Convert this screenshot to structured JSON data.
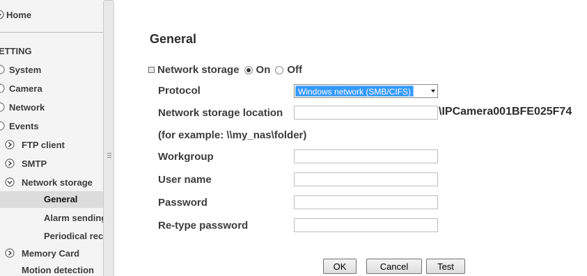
{
  "sidebar": {
    "home_label": "Home",
    "section_label": "ETTING",
    "items": [
      {
        "label": "System"
      },
      {
        "label": "Camera"
      },
      {
        "label": "Network"
      },
      {
        "label": "Events"
      },
      {
        "label": "FTP client"
      },
      {
        "label": "SMTP"
      },
      {
        "label": "Network storage"
      },
      {
        "label": "General"
      },
      {
        "label": "Alarm sending"
      },
      {
        "label": "Periodical recc"
      },
      {
        "label": "Memory Card"
      },
      {
        "label": "Motion detection"
      }
    ],
    "selected": "General"
  },
  "main": {
    "title": "General",
    "network_storage": {
      "label": "Network storage",
      "on_label": "On",
      "off_label": "Off",
      "selected": "On"
    },
    "protocol": {
      "label": "Protocol",
      "value": "Windows network (SMB/CIFS)"
    },
    "location": {
      "label": "Network storage location",
      "value": "",
      "suffix": "\\IPCamera001BFE025F74"
    },
    "example_text": "(for example: \\\\my_nas\\folder)",
    "workgroup": {
      "label": "Workgroup",
      "value": ""
    },
    "username": {
      "label": "User name",
      "value": ""
    },
    "password": {
      "label": "Password",
      "value": ""
    },
    "retype_password": {
      "label": "Re-type password",
      "value": ""
    },
    "buttons": {
      "ok": "OK",
      "cancel": "Cancel",
      "test": "Test"
    }
  },
  "colors": {
    "sidebar_bg": "#f4f4f4",
    "selected_bg": "#dcdcdc",
    "select_highlight": "#3399ff"
  },
  "icons": {
    "home": "home-icon",
    "bullet": "bullet-icon",
    "expand": "expand-arrow-icon",
    "collapse": "collapse-arrow-icon",
    "splitter_grip": "grip-icon"
  }
}
